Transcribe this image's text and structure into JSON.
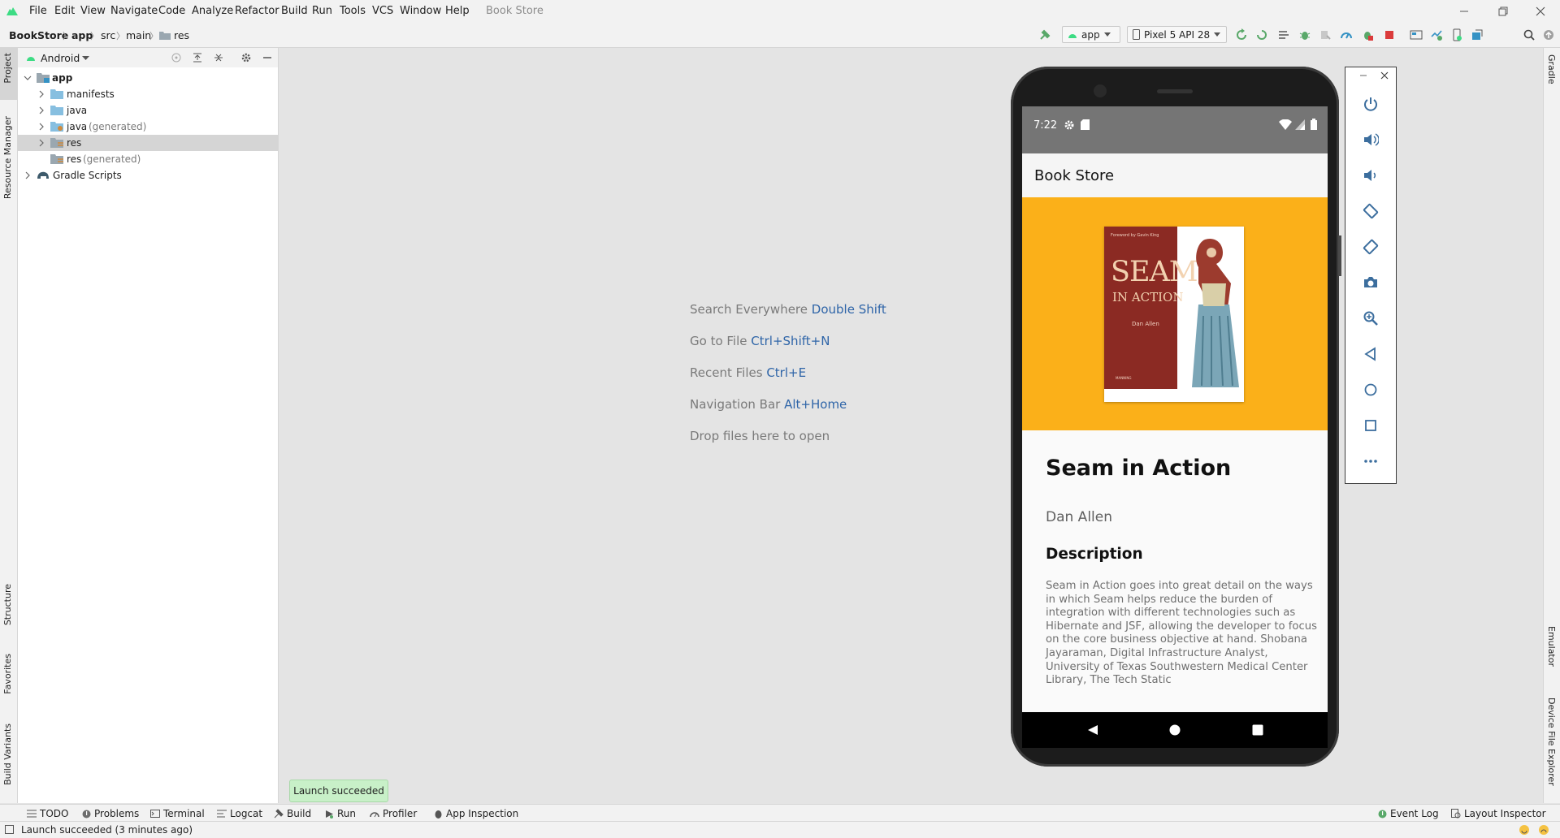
{
  "menu": {
    "items": [
      "File",
      "Edit",
      "View",
      "Navigate",
      "Code",
      "Analyze",
      "Refactor",
      "Build",
      "Run",
      "Tools",
      "VCS",
      "Window",
      "Help"
    ],
    "project_title": "Book Store"
  },
  "breadcrumb": {
    "project": "BookStore",
    "module": "app",
    "src": "src",
    "main": "main",
    "res": "res"
  },
  "toolbar": {
    "run_config": "app",
    "device": "Pixel 5 API 28"
  },
  "left_strip": {
    "project": "Project",
    "resource_manager": "Resource Manager",
    "structure": "Structure",
    "favorites": "Favorites",
    "build_variants": "Build Variants"
  },
  "project_panel": {
    "view_mode": "Android",
    "tree": {
      "app": "app",
      "manifests": "manifests",
      "java": "java",
      "java_generated_name": "java",
      "java_generated_suffix": "(generated)",
      "res": "res",
      "res_generated_name": "res",
      "res_generated_suffix": "(generated)",
      "gradle_scripts": "Gradle Scripts"
    }
  },
  "editor_hints": {
    "h1_text": "Search Everywhere",
    "h1_key": "Double Shift",
    "h2_text": "Go to File",
    "h2_key": "Ctrl+Shift+N",
    "h3_text": "Recent Files",
    "h3_key": "Ctrl+E",
    "h4_text": "Navigation Bar",
    "h4_key": "Alt+Home",
    "h5_text": "Drop files here to open"
  },
  "right_strip": {
    "gradle": "Gradle",
    "emulator": "Emulator",
    "device_file_explorer": "Device File Explorer"
  },
  "phone": {
    "time": "7:22",
    "app_title": "Book Store",
    "cover": {
      "series": "Foreword by Gavin King",
      "title_line1": "SEAM",
      "title_line2": "IN ACTION",
      "author": "Dan Allen",
      "publisher": "MANNING"
    },
    "book_title": "Seam in Action",
    "book_author": "Dan Allen",
    "description_heading": "Description",
    "description": "Seam in Action goes into great detail on the ways in which Seam helps reduce the burden of integration with different technologies such as Hibernate and JSF, allowing the developer to focus on the core business objective at hand.       Shobana Jayaraman, Digital Infrastructure Analyst, University of Texas Southwestern Medical Center Library, The Tech Static",
    "cover_bg": "#fbb019",
    "status_bar_bg": "#757575"
  },
  "bottom_bar": {
    "toast": "Launch succeeded",
    "todo": "TODO",
    "problems": "Problems",
    "terminal": "Terminal",
    "logcat": "Logcat",
    "build": "Build",
    "run": "Run",
    "profiler": "Profiler",
    "app_inspection": "App Inspection",
    "event_log": "Event Log",
    "layout_inspector": "Layout Inspector"
  },
  "status_bar": {
    "message": "Launch succeeded (3 minutes ago)"
  },
  "colors": {
    "accent_link": "#2f65a8",
    "android_green": "#3ddc84",
    "stop_red": "#db3b3b"
  }
}
